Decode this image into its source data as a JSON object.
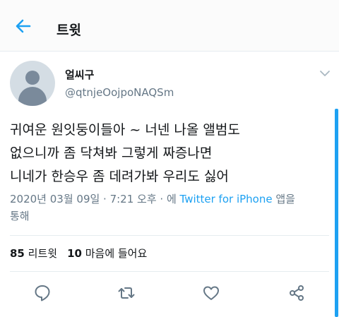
{
  "header": {
    "title": "트윗"
  },
  "user": {
    "display_name": "얼씨구",
    "handle": "@qtnjeOojpoNAQSm"
  },
  "tweet": {
    "lines": [
      "귀여운 원잇둥이들아 ~ 너넨 나올 앨범도",
      "없으니까 좀 닥쳐봐 그렇게 짜증나면",
      "니네가 한승우 좀 데려가봐 우리도 싫어"
    ],
    "timestamp_prefix": "2020년 03월 09일 · 7:21 오후 · 에 ",
    "source": "Twitter for iPhone",
    "timestamp_suffix": " 앱을",
    "timestamp_line2": "통해"
  },
  "stats": {
    "retweets_count": "85",
    "retweets_label": "리트윗",
    "likes_count": "10",
    "likes_label": "마음에 들어요"
  },
  "icons": [
    "back-arrow-icon",
    "chevron-down-icon",
    "reply-icon",
    "retweet-icon",
    "like-icon",
    "share-icon"
  ],
  "colors": {
    "accent": "#1da1f2",
    "secondary_text": "#657786",
    "icon": "#657786"
  }
}
